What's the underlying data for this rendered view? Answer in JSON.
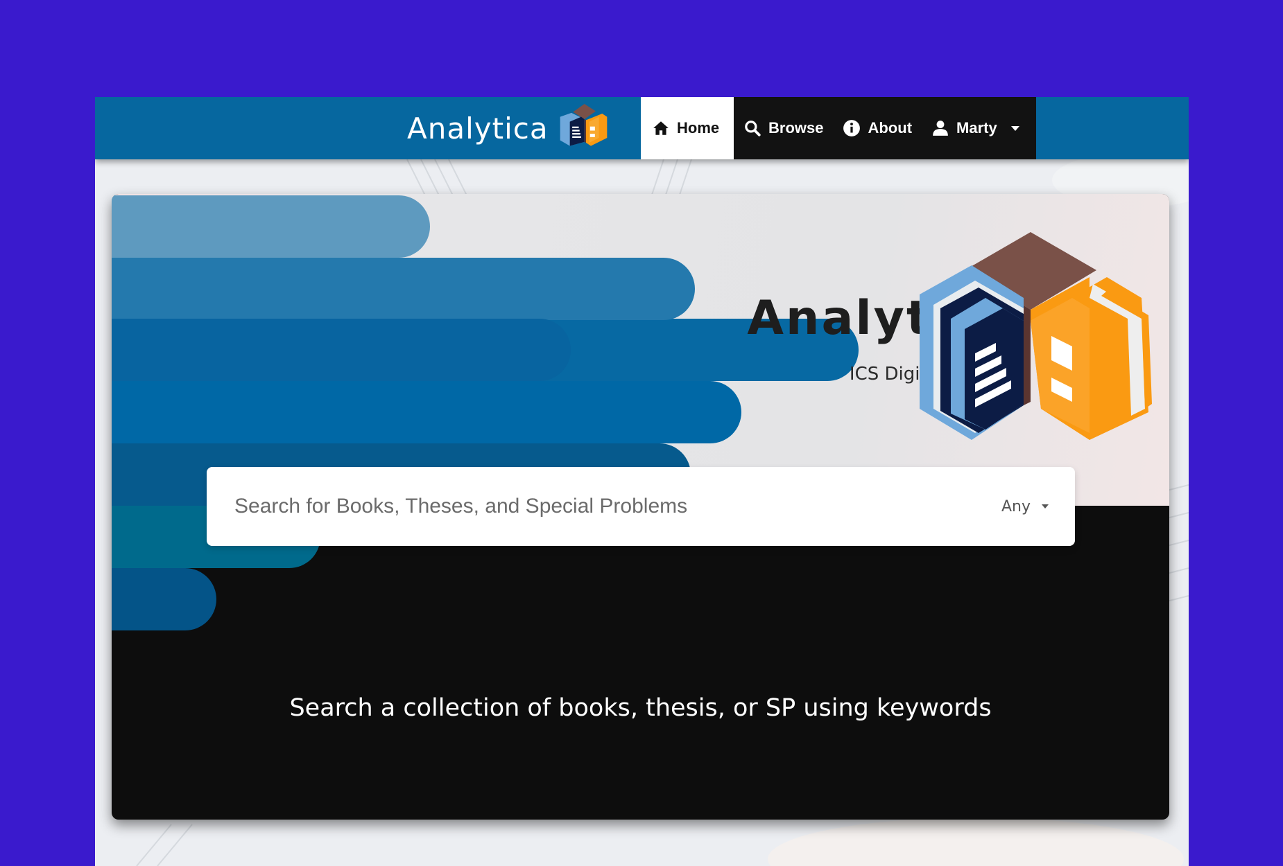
{
  "navbar": {
    "brand": "Analytica",
    "items": [
      {
        "label": "Home",
        "icon": "home-icon",
        "active": true
      },
      {
        "label": "Browse",
        "icon": "search-icon"
      },
      {
        "label": "About",
        "icon": "info-icon"
      },
      {
        "label": "Marty",
        "icon": "user-icon"
      }
    ]
  },
  "hero": {
    "title": "Analytica",
    "subtitle": "ICS Digital Library",
    "tagline": "Search a collection of books, thesis, or SP using keywords"
  },
  "search": {
    "placeholder": "Search for Books, Theses, and Special Problems",
    "filter_value": "Any"
  },
  "colors": {
    "page_background": "#3a1acd",
    "navbar": "#06679f",
    "nav_menu": "#121212",
    "logo_brown": "#7a5148",
    "logo_orange": "#fa9a12",
    "logo_navy": "#0c1c45",
    "logo_lightblue": "#6fa8db"
  }
}
